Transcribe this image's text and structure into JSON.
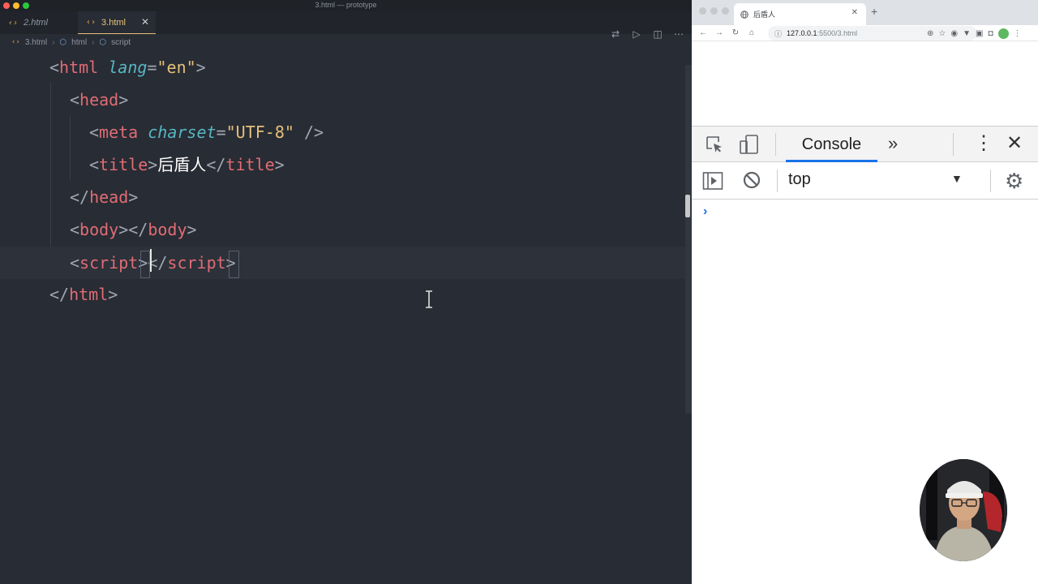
{
  "window": {
    "title": "3.html — prototype"
  },
  "tabs": [
    {
      "label": "2.html"
    },
    {
      "label": "3.html"
    }
  ],
  "breadcrumb": {
    "file": "3.html",
    "sep": "›",
    "node1": "html",
    "node2": "script"
  },
  "code": {
    "l1_open": "<",
    "l1_tag": "html",
    "l1_attr": "lang",
    "l1_eq": "=",
    "l1_val": "\"en\"",
    "l1_close": ">",
    "l2_open": "<",
    "l2_tag": "head",
    "l2_close": ">",
    "l3_open": "<",
    "l3_tag": "meta",
    "l3_attr": "charset",
    "l3_eq": "=",
    "l3_val": "\"UTF-8\"",
    "l3_close": " />",
    "l4_open": "<",
    "l4_tag": "title",
    "l4_mid": ">",
    "l4_text": "后盾人",
    "l4_open2": "</",
    "l4_tag2": "title",
    "l4_close": ">",
    "l5_open": "</",
    "l5_tag": "head",
    "l5_close": ">",
    "l6_open": "<",
    "l6_tag": "body",
    "l6_mid": "></",
    "l6_tag2": "body",
    "l6_close": ">",
    "l7_open": "<",
    "l7_tag": "script",
    "l7_mid": "></",
    "l7_tag2": "script",
    "l7_close": ">",
    "l8_open": "</",
    "l8_tag": "html",
    "l8_close": ">"
  },
  "browser": {
    "tab_title": "后盾人",
    "url_host": "127.0.0.1",
    "url_rest": ":5500/3.html"
  },
  "devtools": {
    "active_tab": "Console",
    "context": "top",
    "prompt": "›"
  },
  "icons": {
    "tab_close": "close-icon",
    "new_tab": "plus-icon",
    "inspect": "inspect-element-icon",
    "device": "device-toolbar-icon",
    "more_tabs": "chevron-double-right-icon",
    "kebab": "more-vert-icon",
    "close_devtools": "close-icon",
    "sidebar": "show-sidebar-icon",
    "clear": "clear-console-icon",
    "gear": "gear-icon"
  },
  "colors": {
    "editor_bg": "#282c34",
    "tag_name": "#e06c75",
    "attribute": "#56b6c2",
    "string": "#e5c07b",
    "accent_blue": "#1a73e8"
  }
}
